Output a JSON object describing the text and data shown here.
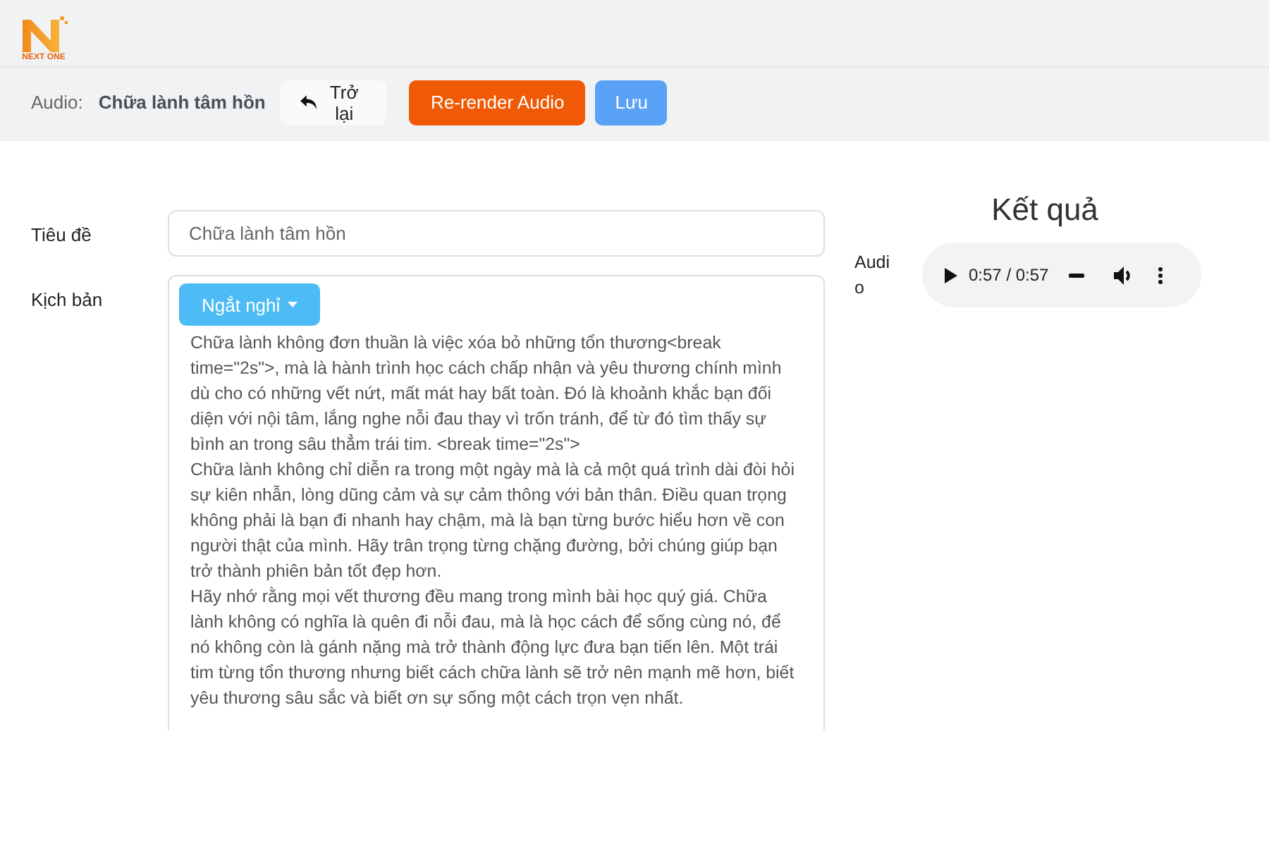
{
  "logo": {
    "text": "NEXT ONE"
  },
  "toolbar": {
    "label": "Audio:",
    "name": "Chữa lành tâm hồn",
    "buttons": [
      {
        "kind": "back",
        "label": "Trở lại"
      },
      {
        "kind": "render",
        "label": "Re-render Audio"
      },
      {
        "kind": "save",
        "label": "Lưu"
      }
    ]
  },
  "form": {
    "title_label": "Tiêu đề",
    "title_value": "Chữa lành tâm hồn",
    "script_label": "Kịch bản",
    "insert_button": "Ngắt nghỉ",
    "script_paragraphs": [
      "Chữa lành không đơn thuần là việc xóa bỏ những tổn thương<break time=\"2s\">, mà là hành trình học cách chấp nhận và yêu thương chính mình dù cho có những vết nứt, mất mát hay bất toàn. Đó là khoảnh khắc bạn đối diện với nội tâm, lắng nghe nỗi đau thay vì trốn tránh, để từ đó tìm thấy sự bình an trong sâu thẳm trái tim. <break time=\"2s\">",
      "Chữa lành không chỉ diễn ra trong một ngày mà là cả một quá trình dài đòi hỏi sự kiên nhẫn, lòng dũng cảm và sự cảm thông với bản thân. Điều quan trọng không phải là bạn đi nhanh hay chậm, mà là bạn từng bước hiểu hơn về con người thật của mình. Hãy trân trọng từng chặng đường, bởi chúng giúp bạn trở thành phiên bản tốt đẹp hơn.",
      "Hãy nhớ rằng mọi vết thương đều mang trong mình bài học quý giá. Chữa lành không có nghĩa là quên đi nỗi đau, mà là học cách để sống cùng nó, để nó không còn là gánh nặng mà trở thành động lực đưa bạn tiến lên. Một trái tim từng tổn thương nhưng biết cách chữa lành sẽ trở nên mạnh mẽ hơn, biết yêu thương sâu sắc và biết ơn sự sống một cách trọn vẹn nhất."
    ]
  },
  "result": {
    "heading": "Kết quả",
    "audio_label": "Audio",
    "player": {
      "time": "0:57 / 0:57"
    }
  }
}
